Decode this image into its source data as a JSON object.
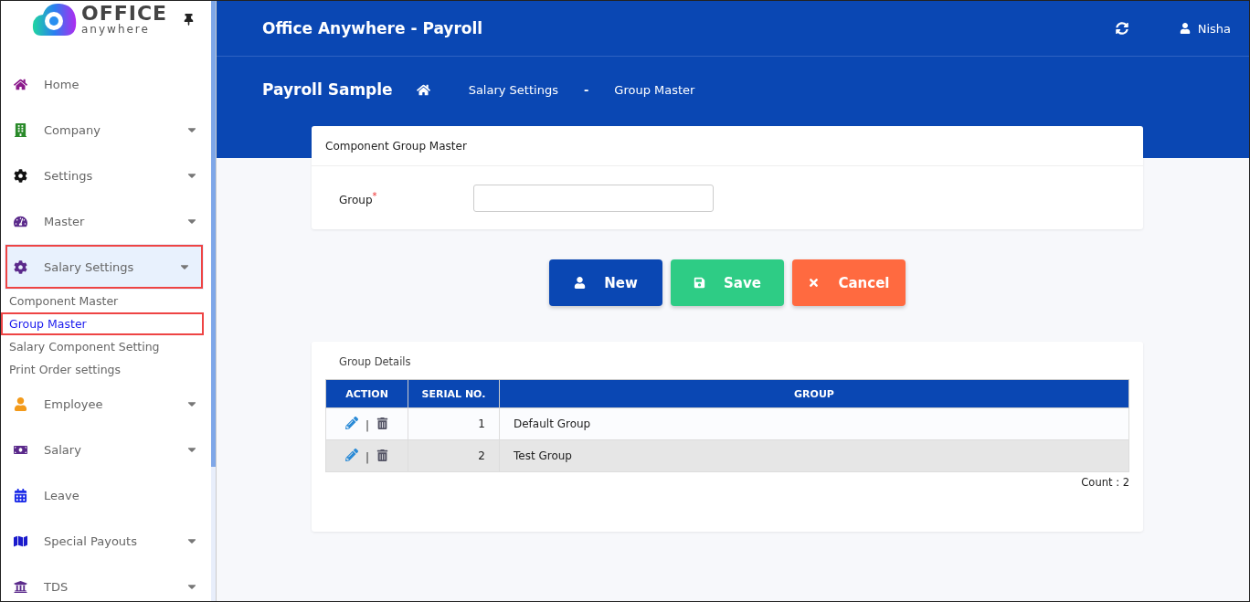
{
  "sidebar": {
    "logo": {
      "word": "OFFICE",
      "tagline": "anywhere"
    },
    "items": [
      {
        "label": "Home",
        "has_caret": false,
        "expanded": false
      },
      {
        "label": "Company",
        "has_caret": true,
        "expanded": false
      },
      {
        "label": "Settings",
        "has_caret": true,
        "expanded": false
      },
      {
        "label": "Master",
        "has_caret": true,
        "expanded": false
      },
      {
        "label": "Salary Settings",
        "has_caret": true,
        "expanded": true,
        "children": [
          {
            "label": "Component Master",
            "selected": false
          },
          {
            "label": "Group Master",
            "selected": true
          },
          {
            "label": "Salary Component Setting",
            "selected": false
          },
          {
            "label": "Print Order settings",
            "selected": false
          }
        ]
      },
      {
        "label": "Employee",
        "has_caret": true,
        "expanded": false
      },
      {
        "label": "Salary",
        "has_caret": true,
        "expanded": false
      },
      {
        "label": "Leave",
        "has_caret": false,
        "expanded": false
      },
      {
        "label": "Special Payouts",
        "has_caret": true,
        "expanded": false
      },
      {
        "label": "TDS",
        "has_caret": true,
        "expanded": false
      }
    ]
  },
  "header": {
    "title": "Office Anywhere - Payroll",
    "user": "Nisha"
  },
  "breadcrumb": {
    "company": "Payroll Sample",
    "path": [
      "Salary Settings",
      "Group Master"
    ],
    "separator": "-"
  },
  "form": {
    "title": "Component Group Master",
    "field_label": "Group",
    "required_mark": "*"
  },
  "buttons": [
    {
      "label": "New",
      "kind": "new"
    },
    {
      "label": "Save",
      "kind": "save"
    },
    {
      "label": "Cancel",
      "kind": "cancel"
    }
  ],
  "table": {
    "title": "Group Details",
    "columns": [
      "ACTION",
      "SERIAL NO.",
      "GROUP"
    ],
    "rows": [
      {
        "serial": "1",
        "group": "Default Group",
        "separator": "|"
      },
      {
        "serial": "2",
        "group": "Test Group",
        "separator": "|"
      }
    ],
    "count": "Count : 2"
  }
}
